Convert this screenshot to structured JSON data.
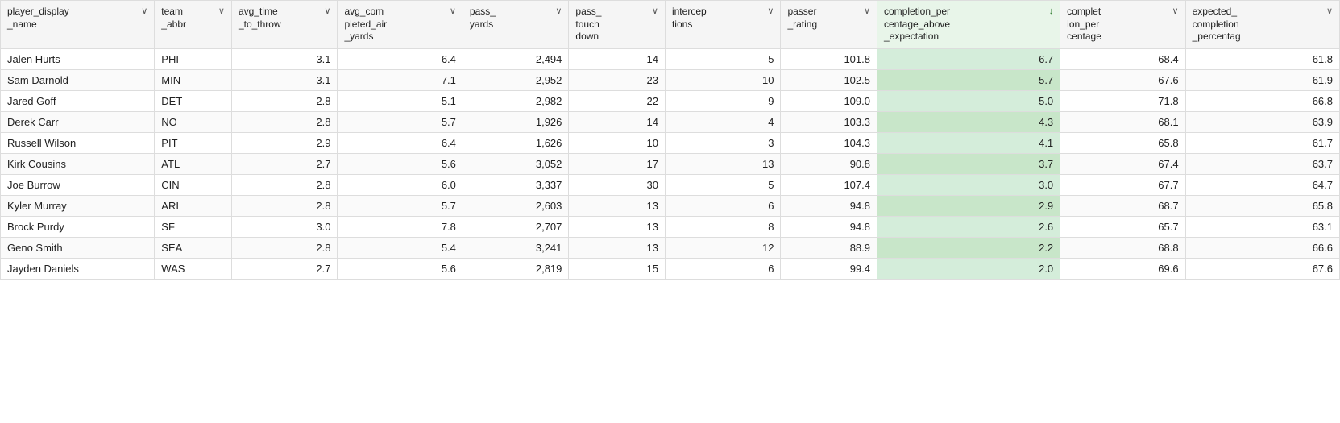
{
  "colors": {
    "header_bg": "#f5f5f5",
    "highlight_col_header": "#e8f5e9",
    "highlight_col_cell": "#d4edda",
    "highlight_col_cell_even": "#c8e6c9",
    "border": "#ddd"
  },
  "columns": [
    {
      "key": "player_display_name",
      "label": "player_display\n_name",
      "align": "left",
      "sortable": true,
      "active_sort": false,
      "sort_dir": "down"
    },
    {
      "key": "team_abbr",
      "label": "team\n_abbr",
      "align": "left",
      "sortable": true,
      "active_sort": false,
      "sort_dir": "down"
    },
    {
      "key": "avg_time_to_throw",
      "label": "avg_time\n_to_throw",
      "align": "right",
      "sortable": true,
      "active_sort": false,
      "sort_dir": "down"
    },
    {
      "key": "avg_completed_air_yards",
      "label": "avg_com\npleted_air\n_yards",
      "align": "right",
      "sortable": true,
      "active_sort": false,
      "sort_dir": "down"
    },
    {
      "key": "pass_yards",
      "label": "pass_\nyards",
      "align": "right",
      "sortable": true,
      "active_sort": false,
      "sort_dir": "down"
    },
    {
      "key": "pass_touchdown",
      "label": "pass_\ntouch\ndown",
      "align": "right",
      "sortable": true,
      "active_sort": false,
      "sort_dir": "down"
    },
    {
      "key": "interceptions",
      "label": "intercep\ntions",
      "align": "right",
      "sortable": true,
      "active_sort": false,
      "sort_dir": "down"
    },
    {
      "key": "passer_rating",
      "label": "passer\n_rating",
      "align": "right",
      "sortable": true,
      "active_sort": false,
      "sort_dir": "down"
    },
    {
      "key": "completion_percentage_above_expectation",
      "label": "completion_per\ncentage_above\n_expectation",
      "align": "right",
      "sortable": true,
      "active_sort": true,
      "sort_dir": "down",
      "highlight": true
    },
    {
      "key": "completion_percentage",
      "label": "complet\nion_per\ncentage",
      "align": "right",
      "sortable": true,
      "active_sort": false,
      "sort_dir": "down"
    },
    {
      "key": "expected_completion_percentage",
      "label": "expected_\ncompletion\n_percentag",
      "align": "right",
      "sortable": true,
      "active_sort": false,
      "sort_dir": "down"
    }
  ],
  "rows": [
    {
      "player_display_name": "Jalen Hurts",
      "team_abbr": "PHI",
      "avg_time_to_throw": "3.1",
      "avg_completed_air_yards": "6.4",
      "pass_yards": "2,494",
      "pass_touchdown": "14",
      "interceptions": "5",
      "passer_rating": "101.8",
      "completion_percentage_above_expectation": "6.7",
      "completion_percentage": "68.4",
      "expected_completion_percentage": "61.8"
    },
    {
      "player_display_name": "Sam Darnold",
      "team_abbr": "MIN",
      "avg_time_to_throw": "3.1",
      "avg_completed_air_yards": "7.1",
      "pass_yards": "2,952",
      "pass_touchdown": "23",
      "interceptions": "10",
      "passer_rating": "102.5",
      "completion_percentage_above_expectation": "5.7",
      "completion_percentage": "67.6",
      "expected_completion_percentage": "61.9"
    },
    {
      "player_display_name": "Jared Goff",
      "team_abbr": "DET",
      "avg_time_to_throw": "2.8",
      "avg_completed_air_yards": "5.1",
      "pass_yards": "2,982",
      "pass_touchdown": "22",
      "interceptions": "9",
      "passer_rating": "109.0",
      "completion_percentage_above_expectation": "5.0",
      "completion_percentage": "71.8",
      "expected_completion_percentage": "66.8"
    },
    {
      "player_display_name": "Derek Carr",
      "team_abbr": "NO",
      "avg_time_to_throw": "2.8",
      "avg_completed_air_yards": "5.7",
      "pass_yards": "1,926",
      "pass_touchdown": "14",
      "interceptions": "4",
      "passer_rating": "103.3",
      "completion_percentage_above_expectation": "4.3",
      "completion_percentage": "68.1",
      "expected_completion_percentage": "63.9"
    },
    {
      "player_display_name": "Russell Wilson",
      "team_abbr": "PIT",
      "avg_time_to_throw": "2.9",
      "avg_completed_air_yards": "6.4",
      "pass_yards": "1,626",
      "pass_touchdown": "10",
      "interceptions": "3",
      "passer_rating": "104.3",
      "completion_percentage_above_expectation": "4.1",
      "completion_percentage": "65.8",
      "expected_completion_percentage": "61.7"
    },
    {
      "player_display_name": "Kirk Cousins",
      "team_abbr": "ATL",
      "avg_time_to_throw": "2.7",
      "avg_completed_air_yards": "5.6",
      "pass_yards": "3,052",
      "pass_touchdown": "17",
      "interceptions": "13",
      "passer_rating": "90.8",
      "completion_percentage_above_expectation": "3.7",
      "completion_percentage": "67.4",
      "expected_completion_percentage": "63.7"
    },
    {
      "player_display_name": "Joe Burrow",
      "team_abbr": "CIN",
      "avg_time_to_throw": "2.8",
      "avg_completed_air_yards": "6.0",
      "pass_yards": "3,337",
      "pass_touchdown": "30",
      "interceptions": "5",
      "passer_rating": "107.4",
      "completion_percentage_above_expectation": "3.0",
      "completion_percentage": "67.7",
      "expected_completion_percentage": "64.7"
    },
    {
      "player_display_name": "Kyler Murray",
      "team_abbr": "ARI",
      "avg_time_to_throw": "2.8",
      "avg_completed_air_yards": "5.7",
      "pass_yards": "2,603",
      "pass_touchdown": "13",
      "interceptions": "6",
      "passer_rating": "94.8",
      "completion_percentage_above_expectation": "2.9",
      "completion_percentage": "68.7",
      "expected_completion_percentage": "65.8"
    },
    {
      "player_display_name": "Brock Purdy",
      "team_abbr": "SF",
      "avg_time_to_throw": "3.0",
      "avg_completed_air_yards": "7.8",
      "pass_yards": "2,707",
      "pass_touchdown": "13",
      "interceptions": "8",
      "passer_rating": "94.8",
      "completion_percentage_above_expectation": "2.6",
      "completion_percentage": "65.7",
      "expected_completion_percentage": "63.1"
    },
    {
      "player_display_name": "Geno Smith",
      "team_abbr": "SEA",
      "avg_time_to_throw": "2.8",
      "avg_completed_air_yards": "5.4",
      "pass_yards": "3,241",
      "pass_touchdown": "13",
      "interceptions": "12",
      "passer_rating": "88.9",
      "completion_percentage_above_expectation": "2.2",
      "completion_percentage": "68.8",
      "expected_completion_percentage": "66.6"
    },
    {
      "player_display_name": "Jayden Daniels",
      "team_abbr": "WAS",
      "avg_time_to_throw": "2.7",
      "avg_completed_air_yards": "5.6",
      "pass_yards": "2,819",
      "pass_touchdown": "15",
      "interceptions": "6",
      "passer_rating": "99.4",
      "completion_percentage_above_expectation": "2.0",
      "completion_percentage": "69.6",
      "expected_completion_percentage": "67.6"
    }
  ]
}
